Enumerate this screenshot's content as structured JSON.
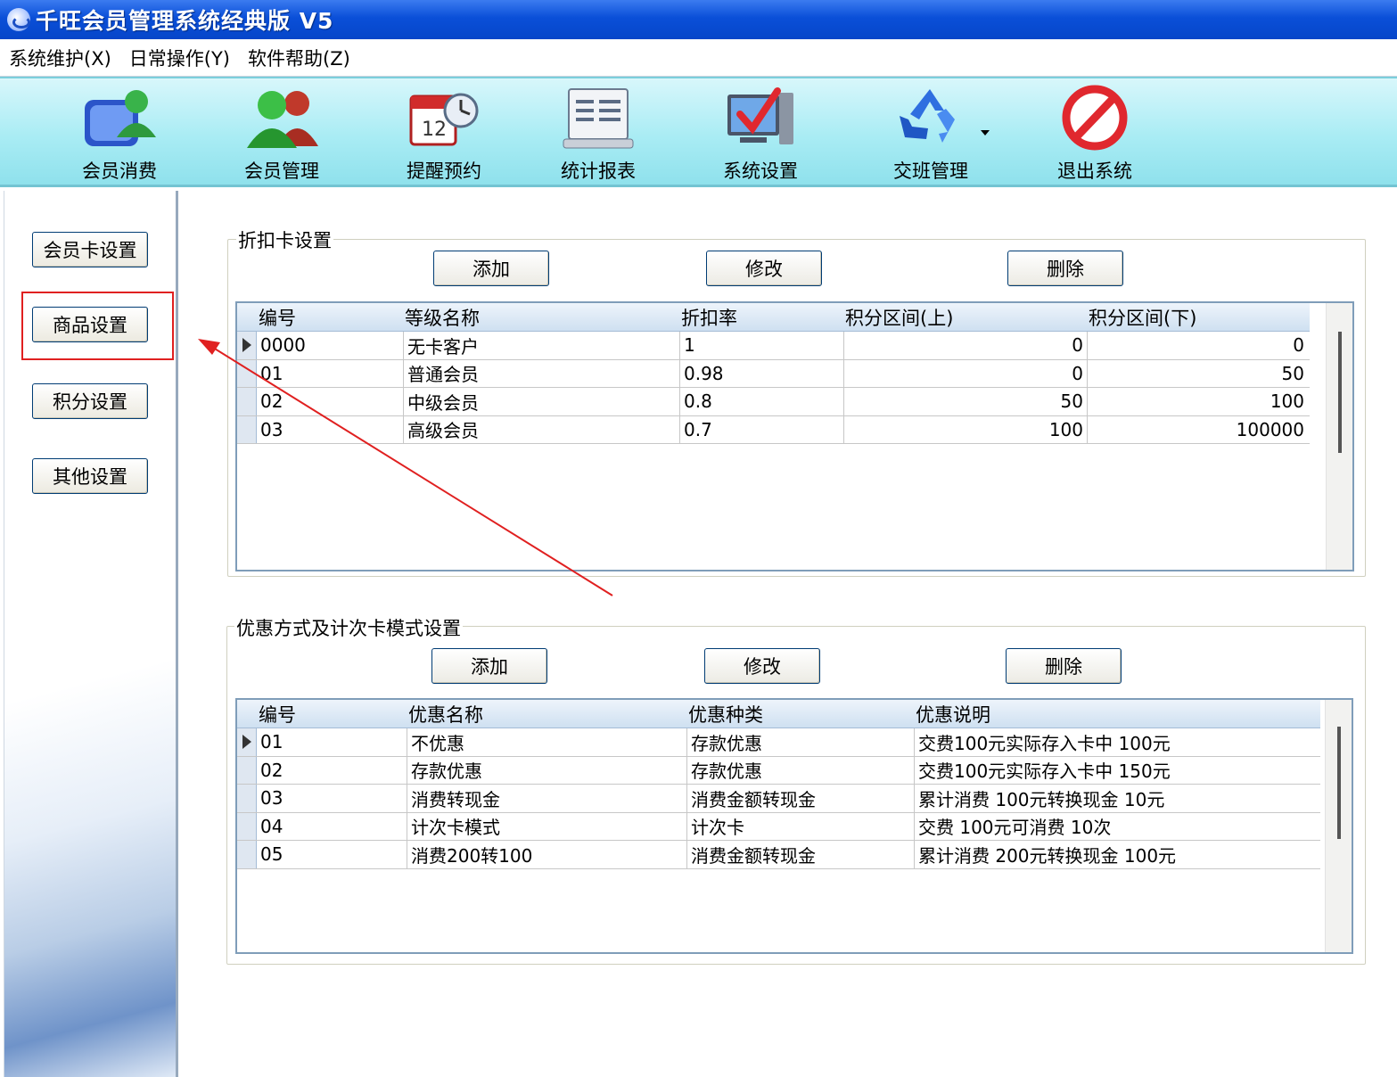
{
  "window": {
    "title": "千旺会员管理系统经典版 V5"
  },
  "menu": [
    {
      "label": "系统维护(X)"
    },
    {
      "label": "日常操作(Y)"
    },
    {
      "label": "软件帮助(Z)"
    }
  ],
  "toolbar": [
    {
      "label": "会员消费",
      "icon": "member-consume-icon"
    },
    {
      "label": "会员管理",
      "icon": "member-manage-icon"
    },
    {
      "label": "提醒预约",
      "icon": "calendar-clock-icon"
    },
    {
      "label": "统计报表",
      "icon": "report-icon"
    },
    {
      "label": "系统设置",
      "icon": "system-settings-icon"
    },
    {
      "label": "交班管理",
      "icon": "recycle-icon"
    },
    {
      "label": "退出系统",
      "icon": "exit-icon"
    }
  ],
  "sidebar": [
    {
      "label": "会员卡设置"
    },
    {
      "label": "商品设置"
    },
    {
      "label": "积分设置"
    },
    {
      "label": "其他设置"
    }
  ],
  "discount_group": {
    "title": "折扣卡设置",
    "buttons": {
      "add": "添加",
      "edit": "修改",
      "delete": "删除"
    },
    "columns": [
      "编号",
      "等级名称",
      "折扣率",
      "积分区间(上)",
      "积分区间(下)"
    ],
    "rows": [
      [
        "0000",
        "无卡客户",
        "1",
        "0",
        "0"
      ],
      [
        "01",
        "普通会员",
        "0.98",
        "0",
        "50"
      ],
      [
        "02",
        "中级会员",
        "0.8",
        "50",
        "100"
      ],
      [
        "03",
        "高级会员",
        "0.7",
        "100",
        "100000"
      ]
    ]
  },
  "promo_group": {
    "title": "优惠方式及计次卡模式设置",
    "buttons": {
      "add": "添加",
      "edit": "修改",
      "delete": "删除"
    },
    "columns": [
      "编号",
      "优惠名称",
      "优惠种类",
      "优惠说明"
    ],
    "rows": [
      [
        "01",
        "不优惠",
        "存款优惠",
        "交费100元实际存入卡中 100元"
      ],
      [
        "02",
        "存款优惠",
        "存款优惠",
        "交费100元实际存入卡中 150元"
      ],
      [
        "03",
        "消费转现金",
        "消费金额转现金",
        "累计消费 100元转换现金 10元"
      ],
      [
        "04",
        "计次卡模式",
        "计次卡",
        "交费 100元可消费 10次"
      ],
      [
        "05",
        "消费200转100",
        "消费金额转现金",
        "累计消费 200元转换现金 100元"
      ]
    ]
  },
  "colors": {
    "title_bar": "#0a4fd8",
    "toolbar": "#a9ecf4",
    "annotation": "#e02020"
  }
}
